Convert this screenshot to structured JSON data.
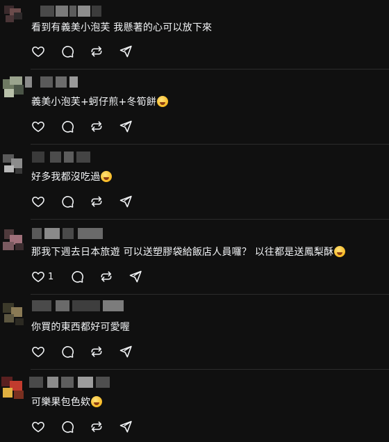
{
  "comments": [
    {
      "text": "看到有義美小泡芙 我懸著的心可以放下來",
      "emoji": "",
      "likes": ""
    },
    {
      "text": "義美小泡芙+蚵仔煎+冬筍餅",
      "emoji": "yum-face",
      "likes": ""
    },
    {
      "text": "好多我都沒吃過",
      "emoji": "zany-face",
      "likes": ""
    },
    {
      "text": "那我下週去日本旅遊 可以送塑膠袋給飯店人員囉？ 以往都是送鳳梨酥",
      "emoji": "grinning-face",
      "likes": "1"
    },
    {
      "text": "你買的東西都好可愛喔",
      "emoji": "",
      "likes": ""
    },
    {
      "text": "可樂果包色欸",
      "emoji": "laughing-tears-face",
      "likes": ""
    }
  ],
  "icons": {
    "like": "heart-icon",
    "reply": "reply-bubble-icon",
    "repost": "repost-icon",
    "share": "share-send-icon"
  },
  "colors": {
    "background": "#101010",
    "text": "#f3f5f7",
    "divider": "#2c2c2c"
  }
}
